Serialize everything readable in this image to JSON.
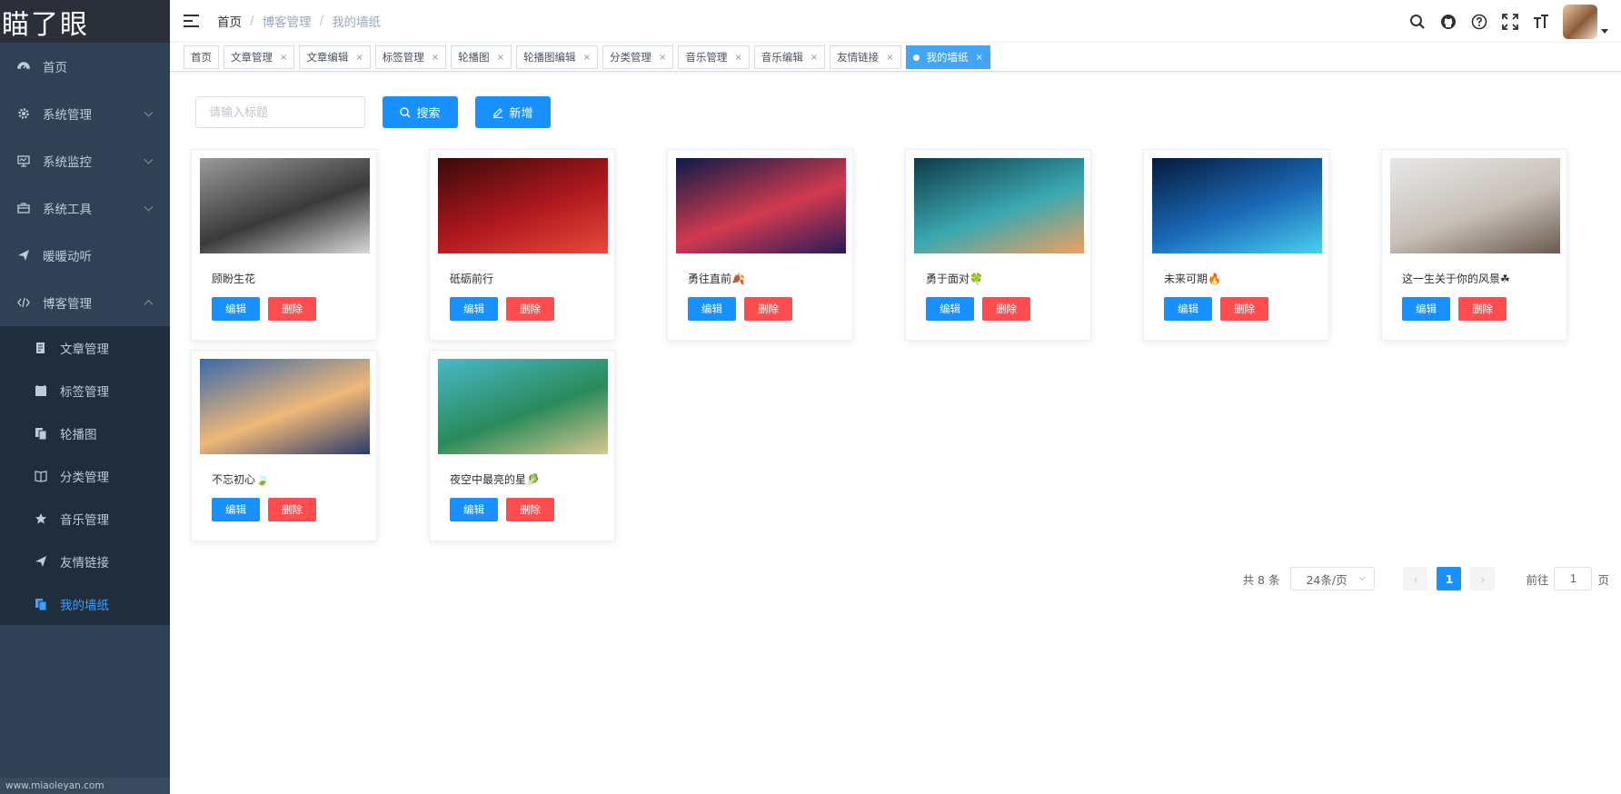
{
  "logo": {
    "text": "瞄了眼"
  },
  "sidebar": {
    "items": [
      {
        "label": "首页",
        "icon": "dashboard-icon"
      },
      {
        "label": "系统管理",
        "icon": "gear-icon"
      },
      {
        "label": "系统监控",
        "icon": "monitor-icon"
      },
      {
        "label": "系统工具",
        "icon": "toolbox-icon"
      },
      {
        "label": "暖暖动听",
        "icon": "send-icon"
      },
      {
        "label": "博客管理",
        "icon": "code-icon"
      }
    ],
    "sub_items": [
      {
        "label": "文章管理",
        "icon": "document-icon"
      },
      {
        "label": "标签管理",
        "icon": "tag-icon"
      },
      {
        "label": "轮播图",
        "icon": "copy-icon"
      },
      {
        "label": "分类管理",
        "icon": "book-icon"
      },
      {
        "label": "音乐管理",
        "icon": "star-icon"
      },
      {
        "label": "友情链接",
        "icon": "send-icon"
      },
      {
        "label": "我的墙纸",
        "icon": "copy-icon"
      }
    ],
    "footer": "www.miaoleyan.com"
  },
  "header": {
    "breadcrumb": {
      "home": "首页",
      "mid": "博客管理",
      "current": "我的墙纸"
    },
    "separator": "/"
  },
  "tags": [
    {
      "label": "首页",
      "closable": false
    },
    {
      "label": "文章管理",
      "closable": true
    },
    {
      "label": "文章编辑",
      "closable": true
    },
    {
      "label": "标签管理",
      "closable": true
    },
    {
      "label": "轮播图",
      "closable": true
    },
    {
      "label": "轮播图编辑",
      "closable": true
    },
    {
      "label": "分类管理",
      "closable": true
    },
    {
      "label": "音乐管理",
      "closable": true
    },
    {
      "label": "音乐编辑",
      "closable": true
    },
    {
      "label": "友情链接",
      "closable": true
    },
    {
      "label": "我的墙纸",
      "closable": true,
      "active": true
    }
  ],
  "toolbar": {
    "search_placeholder": "请输入标题",
    "search_label": "搜索",
    "add_label": "新增"
  },
  "wallpapers": [
    {
      "title": "顾盼生花",
      "colors": [
        "#9a9a9a",
        "#3a3a3a",
        "#d9d9d9"
      ]
    },
    {
      "title": "砥砺前行",
      "colors": [
        "#3a0a0a",
        "#b0181e",
        "#e84a3a"
      ]
    },
    {
      "title": "勇往直前🍂",
      "colors": [
        "#0b1a4a",
        "#d23a4e",
        "#2a1a5a"
      ]
    },
    {
      "title": "勇于面对🍀",
      "colors": [
        "#0f3a4a",
        "#3aa8b0",
        "#f0a060"
      ]
    },
    {
      "title": "未来可期🔥",
      "colors": [
        "#061a3a",
        "#1a6ab8",
        "#4ad0f0"
      ]
    },
    {
      "title": "这一生关于你的风景☘",
      "colors": [
        "#e8e8e8",
        "#c8c0b8",
        "#6a5a50"
      ]
    },
    {
      "title": "不忘初心🍃",
      "colors": [
        "#3a6aa8",
        "#f0b878",
        "#2a3a6a"
      ]
    },
    {
      "title": "夜空中最亮的星🥬",
      "colors": [
        "#4ab8c8",
        "#2a8a5a",
        "#d8c890"
      ]
    }
  ],
  "card_actions": {
    "edit": "编辑",
    "delete": "删除"
  },
  "pagination": {
    "total": "共 8 条",
    "page_size": "24条/页",
    "current_page": "1",
    "goto_label": "前往",
    "goto_value": "1",
    "page_unit": "页"
  },
  "colors": {
    "primary": "#1890ff",
    "danger": "#ff4d4f",
    "sidebar": "#304156",
    "active_menu": "#409eff"
  }
}
